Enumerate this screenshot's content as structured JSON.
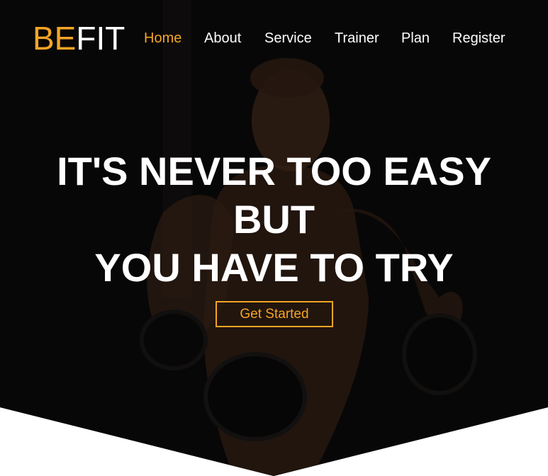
{
  "brand": {
    "prefix": "BE",
    "suffix": "FIT"
  },
  "nav": {
    "items": [
      {
        "label": "Home",
        "active": true
      },
      {
        "label": "About"
      },
      {
        "label": "Service"
      },
      {
        "label": "Trainer"
      },
      {
        "label": "Plan"
      },
      {
        "label": "Register"
      }
    ]
  },
  "hero": {
    "line1": "IT'S NEVER TOO EASY",
    "line2": "BUT",
    "line3": "YOU HAVE TO TRY",
    "cta_label": "Get Started"
  },
  "colors": {
    "accent": "#f5a425",
    "text": "#ffffff",
    "background": "#111111"
  }
}
